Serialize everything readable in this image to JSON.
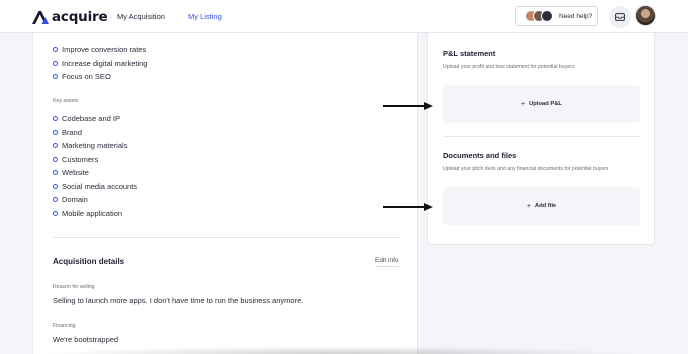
{
  "header": {
    "brand": "acquire",
    "nav": [
      {
        "label": "My Acquisition"
      },
      {
        "label": "My Listing"
      }
    ],
    "help_label": "Need help?"
  },
  "listing": {
    "growth_items": [
      "Improve conversion rates",
      "Increase digital marketing",
      "Focus on SEO"
    ],
    "key_assets_label": "Key assets",
    "key_assets": [
      "Codebase and IP",
      "Brand",
      "Marketing materials",
      "Customers",
      "Website",
      "Social media accounts",
      "Domain",
      "Mobile application"
    ],
    "acquisition": {
      "title": "Acquisition details",
      "edit_label": "Edit info",
      "reason_label": "Reason for selling",
      "reason_value": "Selling to launch more apps. I don't have time to run the business anymore.",
      "financing_label": "Financing",
      "financing_value": "We're bootstrapped"
    }
  },
  "documents": {
    "pnl_title": "P&L statement",
    "pnl_desc": "Upload your profit and loss statement for potential buyers",
    "pnl_button": "Upload P&L",
    "docs_title": "Documents and files",
    "docs_desc": "Upload your pitch deck and any financial documents for potential buyers",
    "docs_button": "Add file"
  },
  "colors": {
    "accent": "#3c50e0",
    "brand_dark": "#16182a"
  }
}
